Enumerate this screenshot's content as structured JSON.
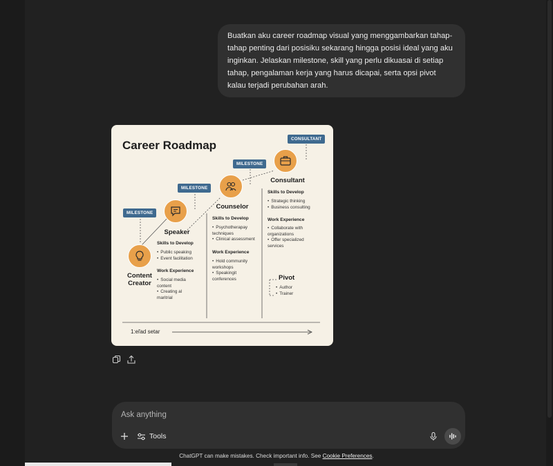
{
  "user_message": "Buatkan aku career roadmap visual yang menggambarkan tahap-tahap penting dari posisiku sekarang hingga posisi ideal yang aku inginkan. Jelaskan milestone, skill yang perlu dikuasai di setiap tahap, pengalaman kerja yang harus dicapai, serta opsi pivot kalau terjadi perubahan arah.",
  "roadmap": {
    "title": "Career Roadmap",
    "badges": {
      "milestone_1": "MILESTONE",
      "milestone_2": "MILESTONE",
      "milestone_3": "MILESTONE",
      "consultant": "CONSULTANT"
    },
    "stages": {
      "content_creator": {
        "role": "Content Creator",
        "skills_title": "Skills to Develop",
        "skills": [
          "Public speaking",
          "Event facilitation"
        ],
        "work_title": "Work Experience",
        "work": [
          "Social media content",
          "Creating al maritrial"
        ]
      },
      "speaker": {
        "role": "Speaker",
        "skills_title": "Skills to Develop",
        "skills": [
          "Psychotherapay techniques",
          "Clinical assessment"
        ],
        "work_title": "Work Experience",
        "work": [
          "Hold community workshops",
          "Speakingit conferences"
        ]
      },
      "counselor": {
        "role": "Counselor",
        "skills_title": "Skills to Develop",
        "skills": [
          "Strategic thinking",
          "Business consulting"
        ],
        "work_title": "Work Experience",
        "work": [
          "Collaborate with organizations",
          "Offer specialized services"
        ]
      },
      "consultant": {
        "role": "Consultant"
      }
    },
    "pivot": {
      "title": "Pivot",
      "items": [
        "Author",
        "Trainer"
      ]
    },
    "timeline_label": "1:eľad setar"
  },
  "composer": {
    "placeholder": "Ask anything",
    "tools_label": "Tools"
  },
  "footer": {
    "disclaimer_prefix": "ChatGPT can make mistakes. Check important info. See ",
    "disclaimer_link": "Cookie Preferences",
    "disclaimer_suffix": "."
  },
  "icons": {
    "copy": "copy-icon",
    "share": "share-icon",
    "plus": "plus-icon",
    "tools": "sliders-icon",
    "mic": "mic-icon",
    "voice": "voice-waveform-icon",
    "lightbulb": "lightbulb-icon",
    "speech": "speech-bubble-icon",
    "people": "people-icon",
    "briefcase": "briefcase-icon"
  },
  "colors": {
    "background": "#212121",
    "bubble": "#303030",
    "card": "#f6f1e6",
    "node": "#e8a04a",
    "badge": "#3f6a8f"
  }
}
